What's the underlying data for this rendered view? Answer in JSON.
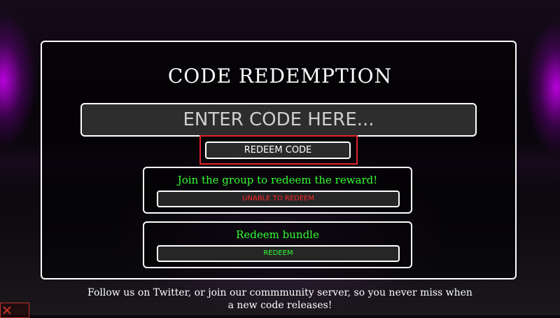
{
  "screen": {
    "title": "CODE REDEMPTION",
    "code_input_placeholder": "ENTER CODE HERE...",
    "redeem_button": "REDEEM CODE"
  },
  "rewards": [
    {
      "description": "Join the group to redeem the reward!",
      "button_label": "UNABLE TO REDEEM",
      "button_color": "#ff2a2a"
    },
    {
      "description": "Redeem bundle",
      "button_label": "REDEEM",
      "button_color": "#33ff33"
    }
  ],
  "footer": {
    "line1": "Follow us on Twitter, or join our commmunity server, so you never miss when",
    "line2": "a new code releases!"
  },
  "colors": {
    "highlight": "#e0242a",
    "accent_glow": "#d600ff",
    "success": "#33ff33",
    "error": "#ff2a2a"
  },
  "icons": {
    "corner": "close-icon"
  }
}
